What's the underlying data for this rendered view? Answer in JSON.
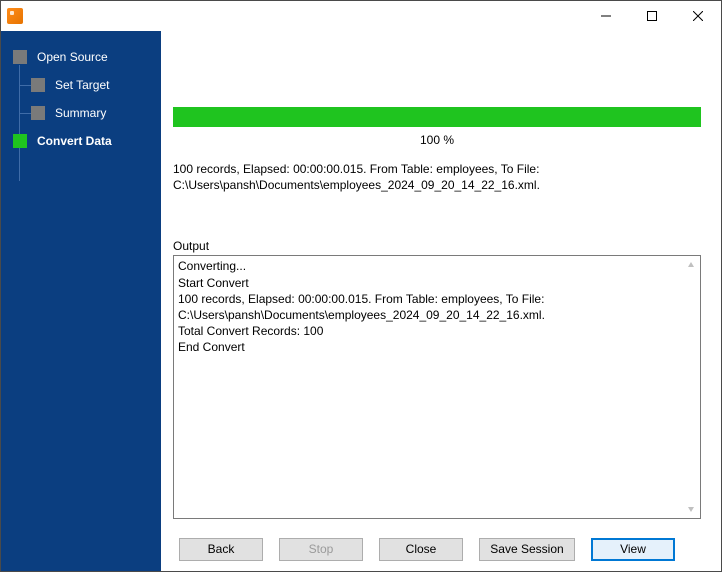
{
  "sidebar": {
    "items": [
      {
        "label": "Open Source"
      },
      {
        "label": "Set Target"
      },
      {
        "label": "Summary"
      },
      {
        "label": "Convert Data"
      }
    ]
  },
  "progress": {
    "percent_label": "100 %"
  },
  "status": {
    "line1": "100 records,    Elapsed: 00:00:00.015.    From Table: employees,    To File:",
    "line2": "C:\\Users\\pansh\\Documents\\employees_2024_09_20_14_22_16.xml."
  },
  "output": {
    "label": "Output",
    "lines": {
      "l1": "Converting...",
      "l2": "Start Convert",
      "l3": "100 records,    Elapsed: 00:00:00.015.    From Table: employees,    To File: C:\\Users\\pansh\\Documents\\employees_2024_09_20_14_22_16.xml.",
      "l4": "Total Convert Records: 100",
      "l5": "End Convert"
    }
  },
  "buttons": {
    "back": "Back",
    "stop": "Stop",
    "close": "Close",
    "save_session": "Save Session",
    "view": "View"
  }
}
